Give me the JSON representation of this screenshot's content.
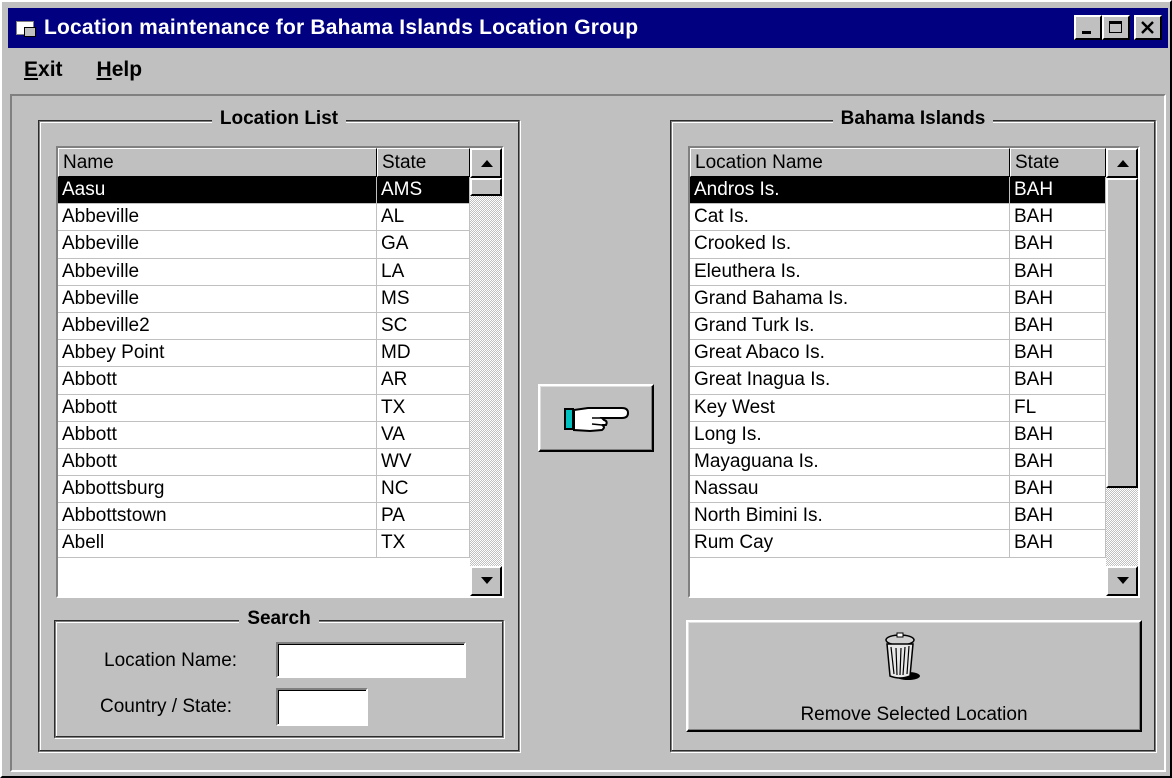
{
  "window": {
    "title": "Location maintenance for Bahama Islands Location Group"
  },
  "menu": {
    "exit_mnemonic": "E",
    "exit_rest": "xit",
    "help_mnemonic": "H",
    "help_rest": "elp"
  },
  "location_list": {
    "title": "Location List",
    "col_name": "Name",
    "col_state": "State",
    "rows": [
      {
        "name": "Aasu",
        "state": "AMS"
      },
      {
        "name": "Abbeville",
        "state": "AL"
      },
      {
        "name": "Abbeville",
        "state": "GA"
      },
      {
        "name": "Abbeville",
        "state": "LA"
      },
      {
        "name": "Abbeville",
        "state": "MS"
      },
      {
        "name": "Abbeville2",
        "state": "SC"
      },
      {
        "name": "Abbey Point",
        "state": "MD"
      },
      {
        "name": "Abbott",
        "state": "AR"
      },
      {
        "name": "Abbott",
        "state": "TX"
      },
      {
        "name": "Abbott",
        "state": "VA"
      },
      {
        "name": "Abbott",
        "state": "WV"
      },
      {
        "name": "Abbottsburg",
        "state": "NC"
      },
      {
        "name": "Abbottstown",
        "state": "PA"
      },
      {
        "name": "Abell",
        "state": "TX"
      }
    ]
  },
  "search": {
    "title": "Search",
    "location_name_label": "Location Name:",
    "location_name_value": "",
    "country_state_label": "Country / State:",
    "country_state_value": ""
  },
  "group_list": {
    "title": "Bahama Islands",
    "col_name": "Location Name",
    "col_state": "State",
    "rows": [
      {
        "name": "Andros Is.",
        "state": "BAH"
      },
      {
        "name": "Cat Is.",
        "state": "BAH"
      },
      {
        "name": "Crooked Is.",
        "state": "BAH"
      },
      {
        "name": "Eleuthera Is.",
        "state": "BAH"
      },
      {
        "name": "Grand Bahama Is.",
        "state": "BAH"
      },
      {
        "name": "Grand Turk Is.",
        "state": "BAH"
      },
      {
        "name": "Great Abaco Is.",
        "state": "BAH"
      },
      {
        "name": "Great Inagua Is.",
        "state": "BAH"
      },
      {
        "name": "Key West",
        "state": "FL"
      },
      {
        "name": "Long Is.",
        "state": "BAH"
      },
      {
        "name": "Mayaguana Is.",
        "state": "BAH"
      },
      {
        "name": "Nassau",
        "state": "BAH"
      },
      {
        "name": "North Bimini Is.",
        "state": "BAH"
      },
      {
        "name": "Rum Cay",
        "state": "BAH"
      }
    ]
  },
  "buttons": {
    "add_icon": "pointing-hand-icon",
    "remove_icon": "trash-can-icon",
    "remove_label": "Remove Selected Location"
  }
}
